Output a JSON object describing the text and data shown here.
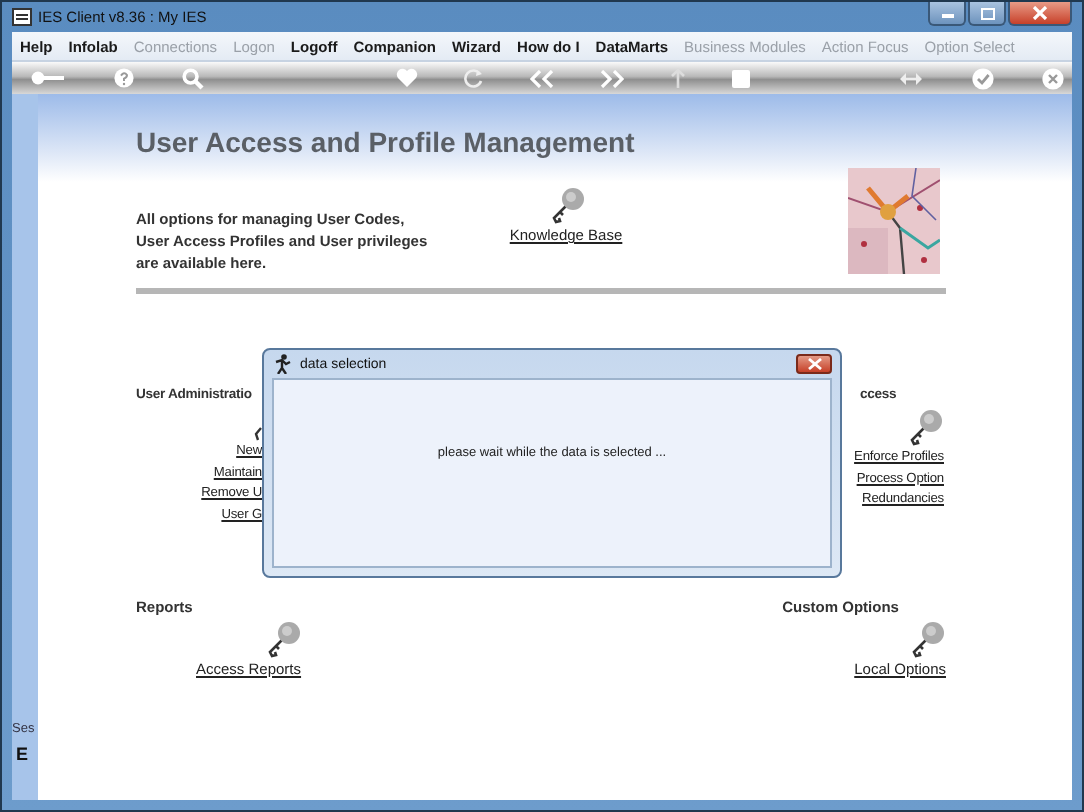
{
  "window": {
    "title": "IES Client v8.36 : My IES"
  },
  "menu": [
    {
      "label": "Help",
      "disabled": false
    },
    {
      "label": "Infolab",
      "disabled": false
    },
    {
      "label": "Connections",
      "disabled": true
    },
    {
      "label": "Logon",
      "disabled": true
    },
    {
      "label": "Logoff",
      "disabled": false
    },
    {
      "label": "Companion",
      "disabled": false
    },
    {
      "label": "Wizard",
      "disabled": false
    },
    {
      "label": "How do I",
      "disabled": false
    },
    {
      "label": "DataMarts",
      "disabled": false
    },
    {
      "label": "Business Modules",
      "disabled": true
    },
    {
      "label": "Action Focus",
      "disabled": true
    },
    {
      "label": "Option Select",
      "disabled": true
    }
  ],
  "side_panel": {
    "label": "Ses",
    "value": "E"
  },
  "page": {
    "title": "User Access and Profile Management",
    "description_lines": [
      "All options for managing User Codes,",
      "User Access Profiles and User privileges",
      "are available here."
    ],
    "knowledge_link": "Knowledge Base",
    "picture": {
      "kind": "picture"
    }
  },
  "sections": [
    {
      "title": "User Administratio",
      "links": [
        "New",
        "Maintain",
        "Remove U",
        "User G"
      ]
    },
    {
      "title": "ccess",
      "links": [
        "Enforce Profiles",
        "Process Option",
        "Redundancies"
      ]
    },
    {
      "title": "Reports",
      "links": [
        "Access Reports"
      ]
    },
    {
      "title": "Custom Options",
      "links": [
        "Local Options"
      ]
    }
  ],
  "dialog": {
    "title": "data selection",
    "message": "please wait while the data is selected ..."
  }
}
